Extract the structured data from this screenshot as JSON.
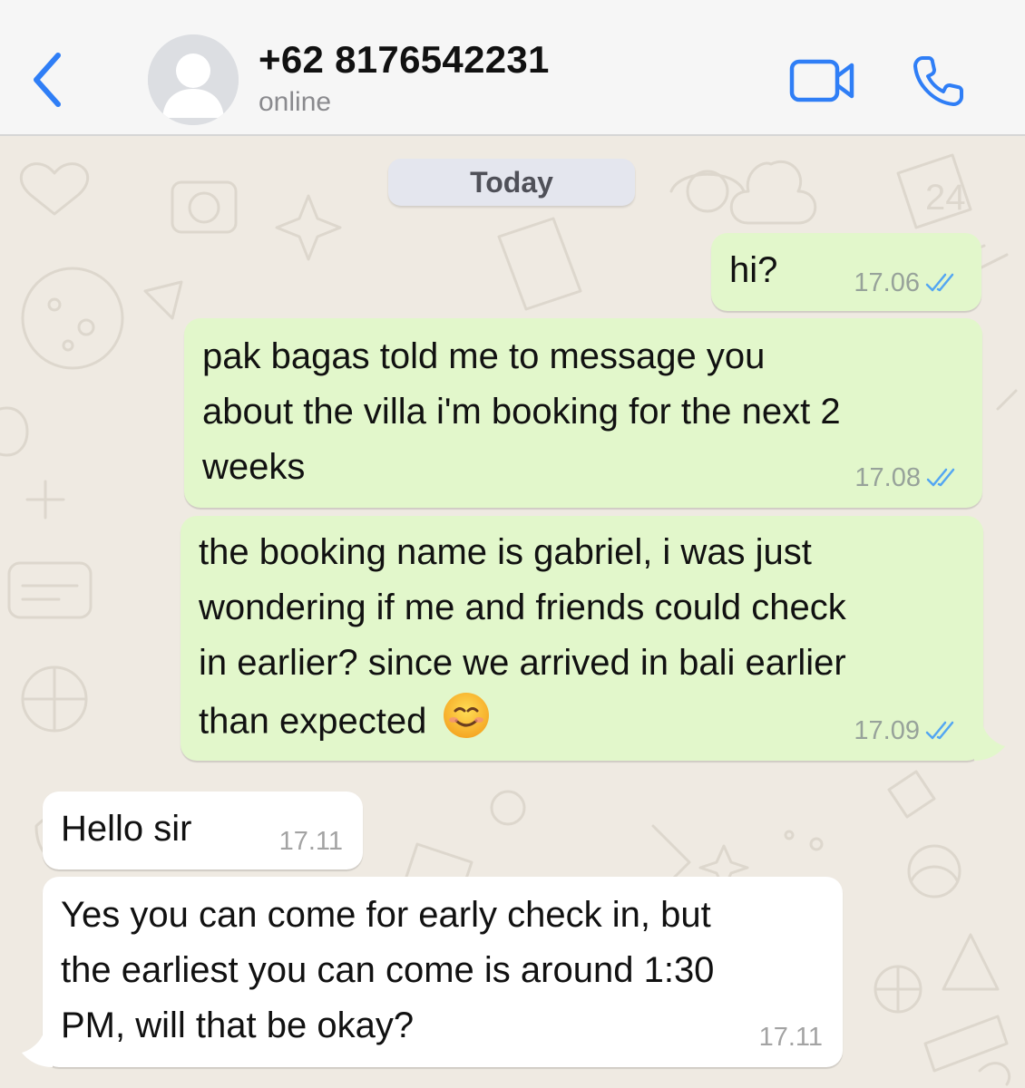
{
  "header": {
    "contact_name": "+62 8176542231",
    "status": "online",
    "back_icon": "chevron-left-icon",
    "video_icon": "video-camera-icon",
    "call_icon": "phone-icon",
    "accent_color": "#2f7ef6"
  },
  "chat": {
    "date_divider": "Today",
    "messages": [
      {
        "direction": "outgoing",
        "lines": [
          "hi?"
        ],
        "time": "17.06",
        "read": true
      },
      {
        "direction": "outgoing",
        "lines": [
          "pak bagas told me to message you",
          "about the villa i'm booking for the next 2",
          "weeks"
        ],
        "time": "17.08",
        "read": true
      },
      {
        "direction": "outgoing",
        "lines": [
          "the booking name is gabriel, i was just",
          "wondering if me and friends could check",
          "in earlier? since we arrived in bali earlier",
          "than expected"
        ],
        "emoji": "☺️",
        "time": "17.09",
        "read": true
      },
      {
        "direction": "incoming",
        "lines": [
          "Hello sir"
        ],
        "time": "17.11"
      },
      {
        "direction": "incoming",
        "lines": [
          "Yes you can come for early check in, but",
          "the earliest you can come is around 1:30",
          "PM, will that be okay?"
        ],
        "time": "17.11"
      }
    ]
  },
  "colors": {
    "outgoing_bubble": "#e2f7cb",
    "incoming_bubble": "#ffffff",
    "chat_background": "#efeae2",
    "read_ticks": "#53a6f2"
  }
}
